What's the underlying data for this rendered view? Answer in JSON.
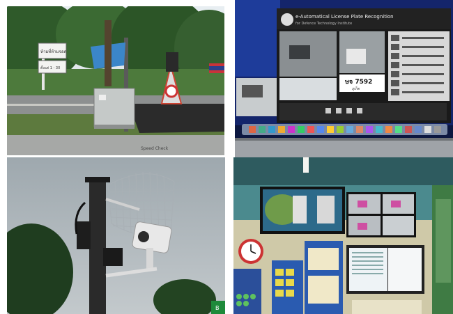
{
  "panels": {
    "roadside": {
      "sign_main": "ห้ามที่ห้ามจอด",
      "sign_sub": "ตั้งแต่ 1 - 30",
      "sign_secondary": "Speed Check"
    },
    "screen": {
      "app_title": "e-Automatical License Plate Recognition",
      "app_subtitle": "for Defence Technology Institute",
      "plate_number": "ษจ 7592",
      "plate_province": "ภูเก็ต"
    },
    "camera": {
      "sign_text": "B"
    },
    "control_room": {}
  }
}
